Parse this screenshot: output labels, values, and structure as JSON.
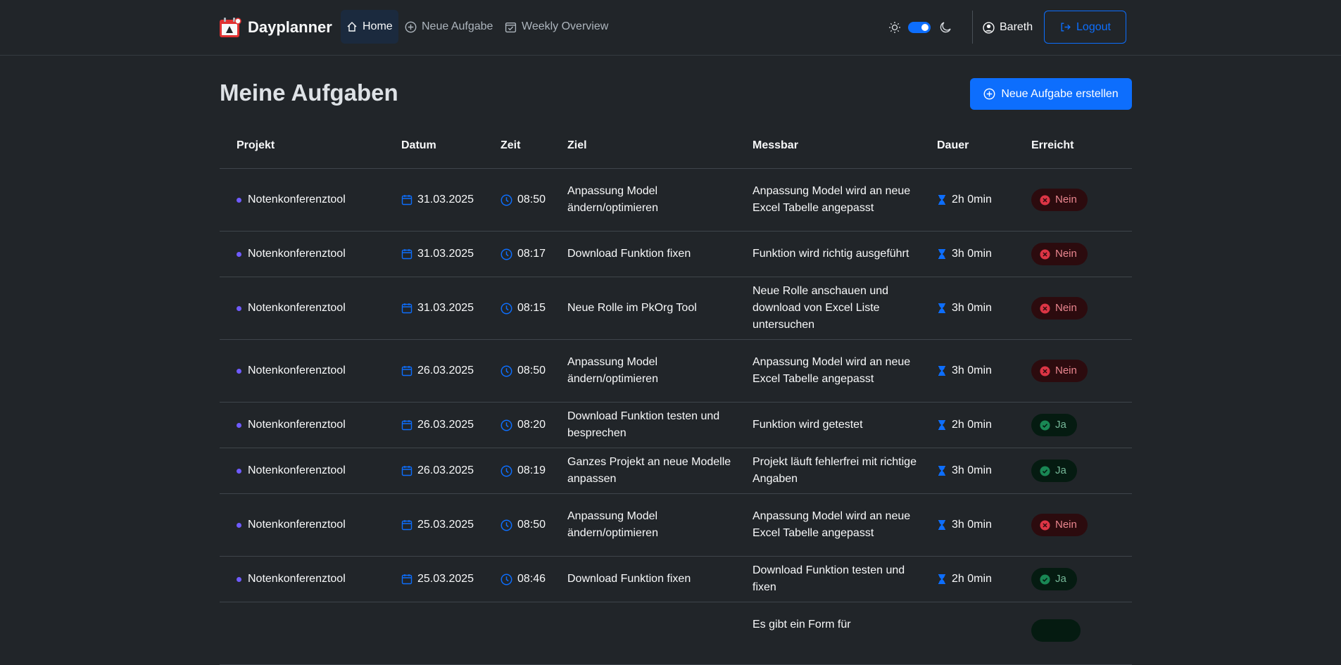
{
  "brand": {
    "name": "Dayplanner"
  },
  "nav": {
    "home": "Home",
    "new_task": "Neue Aufgabe",
    "weekly": "Weekly Overview"
  },
  "user": {
    "name": "Bareth",
    "logout": "Logout"
  },
  "theme": {
    "mode": "dark",
    "toggle_on": true
  },
  "page": {
    "title": "Meine Aufgaben",
    "create_button": "Neue Aufgabe erstellen"
  },
  "table": {
    "headers": [
      "Projekt",
      "Datum",
      "Zeit",
      "Ziel",
      "Messbar",
      "Dauer",
      "Erreicht"
    ],
    "rows": [
      {
        "projekt": "Notenkonferenztool",
        "datum": "31.03.2025",
        "zeit": "08:50",
        "ziel": "Anpassung Model ändern/optimieren",
        "messbar": "Anpassung Model wird an neue Excel Tabelle angepasst",
        "dauer": "2h 0min",
        "erreicht": "Nein",
        "ok": false
      },
      {
        "projekt": "Notenkonferenztool",
        "datum": "31.03.2025",
        "zeit": "08:17",
        "ziel": "Download Funktion fixen",
        "messbar": "Funktion wird richtig ausgeführt",
        "dauer": "3h 0min",
        "erreicht": "Nein",
        "ok": false
      },
      {
        "projekt": "Notenkonferenztool",
        "datum": "31.03.2025",
        "zeit": "08:15",
        "ziel": "Neue Rolle im PkOrg Tool",
        "messbar": "Neue Rolle anschauen und download von Excel Liste untersuchen",
        "dauer": "3h 0min",
        "erreicht": "Nein",
        "ok": false
      },
      {
        "projekt": "Notenkonferenztool",
        "datum": "26.03.2025",
        "zeit": "08:50",
        "ziel": "Anpassung Model ändern/optimieren",
        "messbar": "Anpassung Model wird an neue Excel Tabelle angepasst",
        "dauer": "3h 0min",
        "erreicht": "Nein",
        "ok": false
      },
      {
        "projekt": "Notenkonferenztool",
        "datum": "26.03.2025",
        "zeit": "08:20",
        "ziel": "Download Funktion testen und besprechen",
        "messbar": "Funktion wird getestet",
        "dauer": "2h 0min",
        "erreicht": "Ja",
        "ok": true
      },
      {
        "projekt": "Notenkonferenztool",
        "datum": "26.03.2025",
        "zeit": "08:19",
        "ziel": "Ganzes Projekt an neue Modelle anpassen",
        "messbar": "Projekt läuft fehlerfrei mit richtige Angaben",
        "dauer": "3h 0min",
        "erreicht": "Ja",
        "ok": true
      },
      {
        "projekt": "Notenkonferenztool",
        "datum": "25.03.2025",
        "zeit": "08:50",
        "ziel": "Anpassung Model ändern/optimieren",
        "messbar": "Anpassung Model wird an neue Excel Tabelle angepasst",
        "dauer": "3h 0min",
        "erreicht": "Nein",
        "ok": false
      },
      {
        "projekt": "Notenkonferenztool",
        "datum": "25.03.2025",
        "zeit": "08:46",
        "ziel": "Download Funktion fixen",
        "messbar": "Download Funktion testen und fixen",
        "dauer": "2h 0min",
        "erreicht": "Ja",
        "ok": true
      },
      {
        "projekt": "",
        "datum": "",
        "zeit": "",
        "ziel": "",
        "messbar": "Es gibt ein Form für",
        "dauer": "",
        "erreicht": "",
        "ok": true
      }
    ]
  }
}
